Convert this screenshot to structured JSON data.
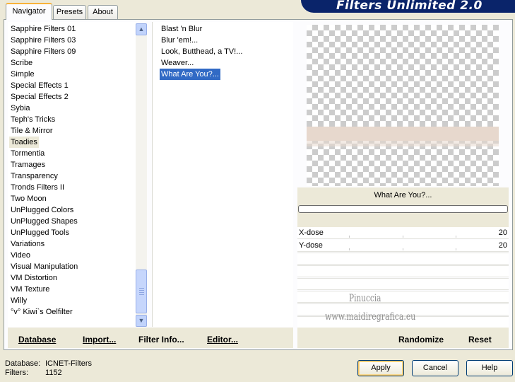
{
  "window": {
    "title": "Filters Unlimited 2.0"
  },
  "tabs": [
    {
      "label": "Navigator",
      "active": true
    },
    {
      "label": "Presets",
      "active": false
    },
    {
      "label": "About",
      "active": false
    }
  ],
  "categories": [
    "Sapphire Filters 01",
    "Sapphire Filters 03",
    "Sapphire Filters 09",
    "Scribe",
    "Simple",
    "Special Effects 1",
    "Special Effects 2",
    "Sybia",
    "Teph's Tricks",
    "Tile & Mirror",
    "Toadies",
    "Tormentia",
    "Tramages",
    "Transparency",
    "Tronds Filters II",
    "Two Moon",
    "UnPlugged Colors",
    "UnPlugged Shapes",
    "UnPlugged Tools",
    "Variations",
    "Video",
    "Visual Manipulation",
    "VM Distortion",
    "VM Texture",
    "Willy",
    "°v° Kiwi`s Oelfilter"
  ],
  "selected_category": "Toadies",
  "filters": [
    "Blast 'n Blur",
    "Blur 'em!...",
    "Look, Butthead, a TV!...",
    "Weaver...",
    "What Are You?..."
  ],
  "selected_filter": "What Are You?...",
  "preview": {
    "filter_name": "What Are You?...",
    "band_color": "#e7d8cd"
  },
  "parameters": [
    {
      "label": "X-dose",
      "value": "20"
    },
    {
      "label": "Y-dose",
      "value": "20"
    }
  ],
  "watermark": {
    "line1": "Pinuccia",
    "line2": "www.maidiregrafica.eu"
  },
  "toolbar": {
    "database": "Database",
    "import": "Import...",
    "filter_info": "Filter Info...",
    "editor": "Editor...",
    "randomize": "Randomize",
    "reset": "Reset"
  },
  "status": {
    "database_label": "Database:",
    "database_value": "ICNET-Filters",
    "filters_label": "Filters:",
    "filters_value": "1152"
  },
  "buttons": {
    "apply": "Apply",
    "cancel": "Cancel",
    "help": "Help"
  },
  "colors": {
    "selection": "#316ac5",
    "banner": "#0a246a",
    "background": "#ece9d8"
  }
}
